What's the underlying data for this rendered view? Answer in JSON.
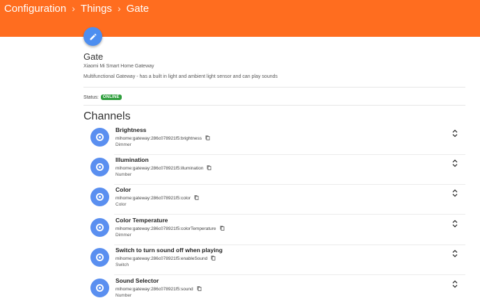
{
  "breadcrumb": [
    "Configuration",
    "Things",
    "Gate"
  ],
  "thing": {
    "name": "Gate",
    "label": "Xiaomi Mi Smart Home Gateway",
    "description": "Multifunctional Gateway - has a built in light and ambient light sensor and can play sounds",
    "status_label": "Status:",
    "status": "ONLINE"
  },
  "channels_heading": "Channels",
  "channels": [
    {
      "title": "Brightness",
      "uid": "mihome:gateway:286c078921f5:brightness",
      "type": "Dimmer"
    },
    {
      "title": "Illumination",
      "uid": "mihome:gateway:286c078921f5:illumination",
      "type": "Number"
    },
    {
      "title": "Color",
      "uid": "mihome:gateway:286c078921f5:color",
      "type": "Color"
    },
    {
      "title": "Color Temperature",
      "uid": "mihome:gateway:286c078921f5:colorTemperature",
      "type": "Dimmer"
    },
    {
      "title": "Switch to turn sound off when playing",
      "uid": "mihome:gateway:286c078921f5:enableSound",
      "type": "Switch"
    },
    {
      "title": "Sound Selector",
      "uid": "mihome:gateway:286c078921f5:sound",
      "type": "Number"
    }
  ],
  "colors": {
    "header": "#ff6d1f",
    "accent": "#5a8ff0",
    "status_online": "#2e9e3c"
  },
  "icons": {
    "edit": "pencil-icon",
    "channel": "radio-button-icon",
    "copy": "copy-icon",
    "expand": "unfold-icon"
  }
}
